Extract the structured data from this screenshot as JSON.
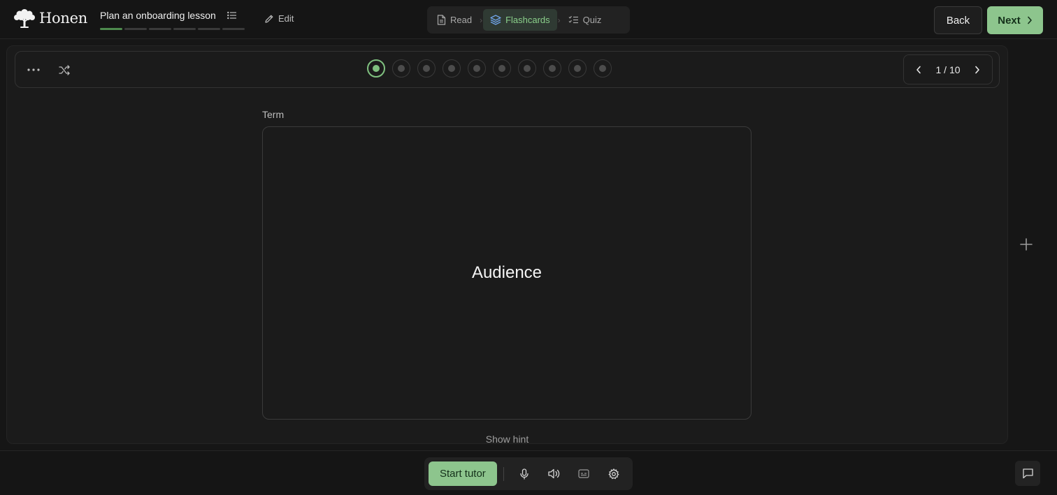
{
  "app": {
    "name": "Honen"
  },
  "lesson": {
    "title": "Plan an onboarding lesson",
    "progress_segments": 6,
    "progress_done": 1
  },
  "header": {
    "edit_label": "Edit",
    "steps": [
      {
        "label": "Read",
        "icon": "document-icon",
        "active": false
      },
      {
        "label": "Flashcards",
        "icon": "layers-icon",
        "active": true
      },
      {
        "label": "Quiz",
        "icon": "checklist-icon",
        "active": false
      }
    ],
    "back_label": "Back",
    "next_label": "Next"
  },
  "flashcards": {
    "total": 10,
    "current": 1,
    "counter": "1 / 10",
    "side_label": "Term",
    "card_text": "Audience",
    "hint_label": "Show hint"
  },
  "bottom": {
    "tutor_label": "Start tutor"
  },
  "colors": {
    "accent": "#8dc58d",
    "active_dot": "#7fc07f",
    "background": "#161616",
    "panel": "#1b1b1b"
  }
}
